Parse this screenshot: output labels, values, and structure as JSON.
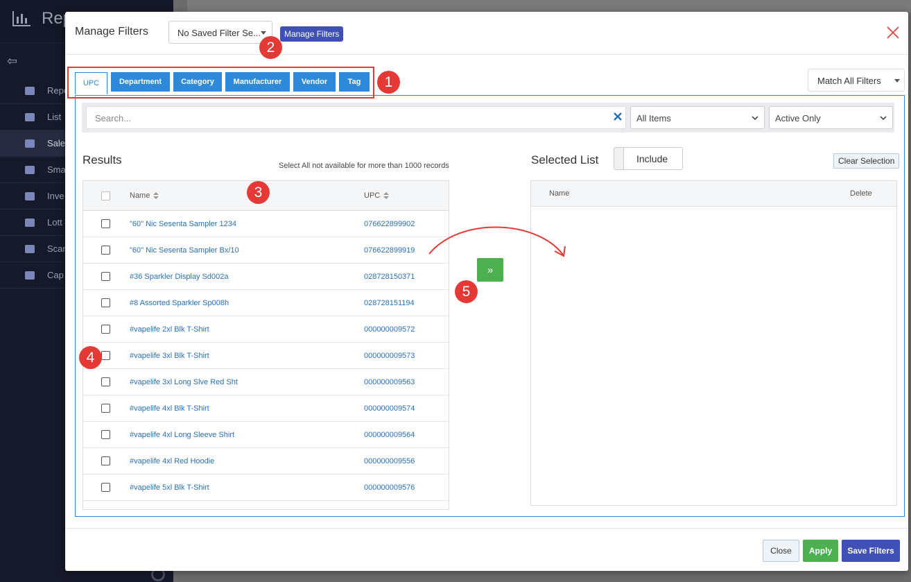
{
  "background": {
    "app_title": "Rep",
    "nav": [
      {
        "label": "Repo",
        "active": false
      },
      {
        "label": "List",
        "active": false
      },
      {
        "label": "Sale",
        "active": true
      },
      {
        "label": "Sma",
        "active": false
      },
      {
        "label": "Inve",
        "active": false
      },
      {
        "label": "Lott",
        "active": false
      },
      {
        "label": "Scar",
        "active": false
      },
      {
        "label": "Cap",
        "active": false
      }
    ]
  },
  "modal": {
    "title": "Manage Filters",
    "saved_filter": {
      "value": "No Saved Filter Se..."
    },
    "manage_tooltip": "Manage Filters",
    "tabs": [
      "UPC",
      "Department",
      "Category",
      "Manufacturer",
      "Vendor",
      "Tag"
    ],
    "active_tab": "UPC",
    "match_filter": "Match All Filters",
    "search": {
      "placeholder": "Search...",
      "items_filter": "All Items",
      "status_filter": "Active Only"
    },
    "results": {
      "title": "Results",
      "note": "Select All not available for more than 1000 records",
      "columns": {
        "name": "Name",
        "upc": "UPC"
      },
      "rows": [
        {
          "name": "\"60\" Nic Sesenta Sampler 1234",
          "upc": "076622899902"
        },
        {
          "name": "\"60\" Nic Sesenta Sampler Bx/10",
          "upc": "076622899919"
        },
        {
          "name": "#36 Sparkler Display Sd002a",
          "upc": "028728150371"
        },
        {
          "name": "#8 Assorted Sparkler Sp008h",
          "upc": "028728151194"
        },
        {
          "name": "#vapelife 2xl Blk T-Shirt",
          "upc": "000000009572"
        },
        {
          "name": "#vapelife 3xl Blk T-Shirt",
          "upc": "000000009573"
        },
        {
          "name": "#vapelife 3xl Long Slve Red Sht",
          "upc": "000000009563"
        },
        {
          "name": "#vapelife 4xl Blk T-Shirt",
          "upc": "000000009574"
        },
        {
          "name": "#vapelife 4xl Long Sleeve Shirt",
          "upc": "000000009564"
        },
        {
          "name": "#vapelife 4xl Red Hoodie",
          "upc": "000000009556"
        },
        {
          "name": "#vapelife 5xl Blk T-Shirt",
          "upc": "000000009576"
        }
      ]
    },
    "move_button": "»",
    "selected": {
      "title": "Selected List",
      "include_label": "Include",
      "clear_label": "Clear Selection",
      "columns": {
        "name": "Name",
        "delete": "Delete"
      }
    },
    "footer": {
      "close": "Close",
      "apply": "Apply",
      "save": "Save Filters"
    }
  },
  "annotations": [
    "1",
    "2",
    "3",
    "4",
    "5"
  ],
  "colors": {
    "primary": "#2e8ad8",
    "success": "#4caf50",
    "indigo": "#3f51b5",
    "annotation": "#e53935"
  }
}
